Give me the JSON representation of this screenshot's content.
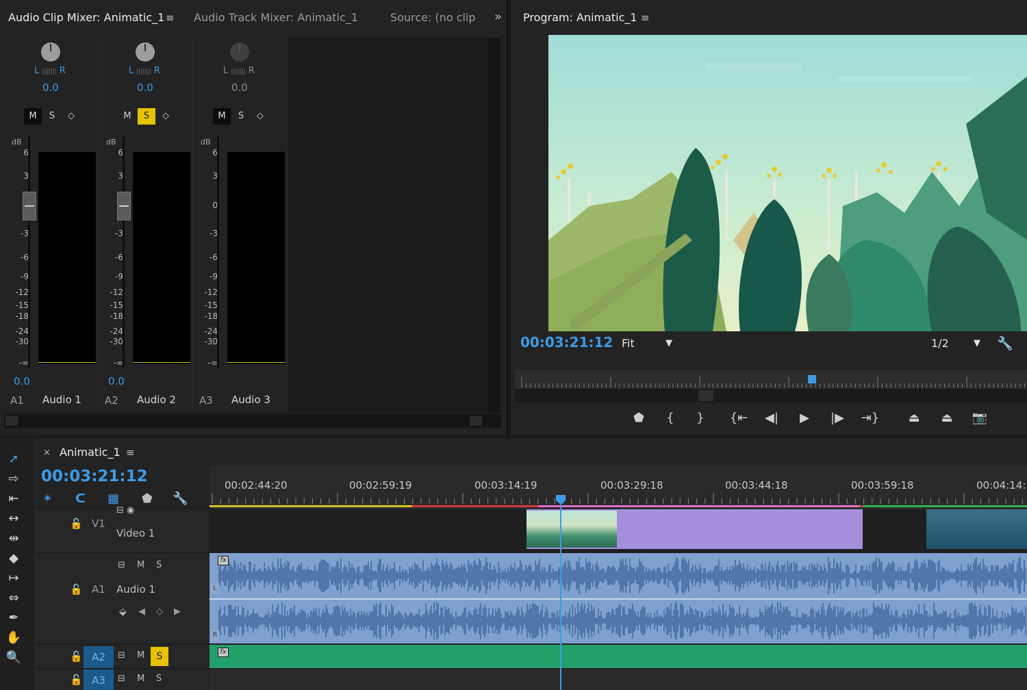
{
  "colors": {
    "accent_blue": "#3d9be6",
    "solo_yellow": "#e6c200",
    "audio_clip": "#7ea1cf",
    "video_clip_purple": "#a58fdc",
    "audio2_clip": "#22a06a"
  },
  "mixer": {
    "tabs": [
      {
        "label": "Audio Clip Mixer: Animatic_1"
      },
      {
        "label": "Audio Track Mixer: Animatic_1"
      },
      {
        "label": "Source: (no clip"
      }
    ],
    "menu_icon": "≡",
    "overflow_icon": "»",
    "db_unit": "dB",
    "db_scale": [
      "6",
      "3",
      "0",
      "-3",
      "-6",
      "-9",
      "-12",
      "-15",
      "-18",
      "-24",
      "-30",
      "-∞"
    ],
    "channels": [
      {
        "id": "A1",
        "name": "Audio 1",
        "pan_left": "L",
        "pan_right": "R",
        "pan_value": "0.0",
        "volume_value": "0.0",
        "mute": "M",
        "solo": "S",
        "keyframe": "◇",
        "mute_on": true,
        "solo_on": false
      },
      {
        "id": "A2",
        "name": "Audio 2",
        "pan_left": "L",
        "pan_right": "R",
        "pan_value": "0.0",
        "volume_value": "0.0",
        "mute": "M",
        "solo": "S",
        "keyframe": "◇",
        "mute_on": false,
        "solo_on": true
      },
      {
        "id": "A3",
        "name": "Audio 3",
        "pan_left": "L",
        "pan_right": "R",
        "pan_value": "0.0",
        "volume_value": "",
        "mute": "M",
        "solo": "S",
        "keyframe": "◇",
        "mute_on": true,
        "solo_on": false
      }
    ]
  },
  "program": {
    "title": "Program: Animatic_1",
    "menu_icon": "≡",
    "timecode": "00:03:21:12",
    "fit_label": "Fit",
    "resolution_label": "1/2",
    "dropdown_icon": "▼",
    "transport": [
      {
        "name": "add-marker-icon",
        "glyph": "⬟"
      },
      {
        "name": "mark-in-icon",
        "glyph": "{"
      },
      {
        "name": "mark-out-icon",
        "glyph": "}"
      },
      {
        "name": "go-to-in-icon",
        "glyph": "{⇤"
      },
      {
        "name": "step-back-icon",
        "glyph": "◀|"
      },
      {
        "name": "play-icon",
        "glyph": "▶"
      },
      {
        "name": "step-forward-icon",
        "glyph": "|▶"
      },
      {
        "name": "go-to-out-icon",
        "glyph": "⇥}"
      },
      {
        "name": "lift-icon",
        "glyph": "⏏"
      },
      {
        "name": "extract-icon",
        "glyph": "⏏"
      },
      {
        "name": "export-frame-icon",
        "glyph": "📷"
      }
    ]
  },
  "timeline": {
    "tab_label": "Animatic_1",
    "close_icon": "×",
    "menu_icon": "≡",
    "timecode": "00:03:21:12",
    "ruler_labels": [
      "00:02:44:20",
      "00:02:59:19",
      "00:03:14:19",
      "00:03:29:18",
      "00:03:44:18",
      "00:03:59:18",
      "00:04:14:"
    ],
    "tracks": {
      "v1": {
        "id": "V1",
        "name": "Video 1"
      },
      "a1": {
        "id": "A1",
        "name": "Audio 1",
        "mute": "M",
        "solo": "S",
        "ch_left": "L",
        "ch_right": "R"
      },
      "a2": {
        "id": "A2",
        "mute": "M",
        "solo": "S"
      },
      "a3": {
        "id": "A3",
        "mute": "M",
        "solo": "S"
      }
    },
    "fx_label": "fx",
    "tools": [
      "selection-tool-icon",
      "track-select-tool-icon",
      "ripple-edit-tool-icon",
      "rolling-edit-tool-icon",
      "rate-stretch-tool-icon",
      "razor-tool-icon",
      "slip-tool-icon",
      "slide-tool-icon",
      "pen-tool-icon",
      "hand-tool-icon",
      "zoom-tool-icon"
    ]
  }
}
